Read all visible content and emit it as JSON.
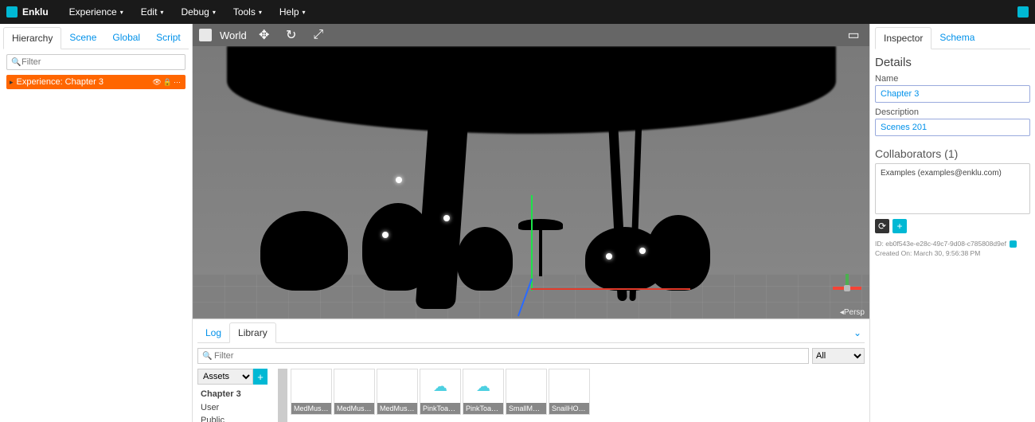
{
  "brand": "Enklu",
  "menus": [
    "Experience",
    "Edit",
    "Debug",
    "Tools",
    "Help"
  ],
  "left": {
    "tabs": [
      "Hierarchy",
      "Scene",
      "Global",
      "Script"
    ],
    "active_tab": 0,
    "filter_placeholder": "Filter",
    "root_item": "Experience: Chapter 3"
  },
  "viewport": {
    "mode": "World",
    "persp": "Persp"
  },
  "bottom": {
    "tabs": [
      "Log",
      "Library"
    ],
    "active_tab": 1,
    "filter_placeholder": "Filter",
    "filter_dd": "All",
    "assets_dd": "Assets",
    "tree": [
      "Chapter 3",
      "User",
      "Public"
    ],
    "tree_selected": 0,
    "assets": [
      "MedMush…",
      "MedMush…",
      "MedMush…",
      "PinkToad…",
      "PinkToad…",
      "SmallMus…",
      "SnailHOLO"
    ]
  },
  "inspector": {
    "tabs": [
      "Inspector",
      "Schema"
    ],
    "active_tab": 0,
    "details_title": "Details",
    "name_label": "Name",
    "name_value": "Chapter 3",
    "desc_label": "Description",
    "desc_value": "Scenes 201",
    "collab_title": "Collaborators (1)",
    "collab_list": "Examples (examples@enklu.com)",
    "id_line": "ID: eb0f543e-e28c-49c7-9d08-c785808d9ef",
    "created_line": "Created On: March 30, 9:56:38 PM"
  }
}
